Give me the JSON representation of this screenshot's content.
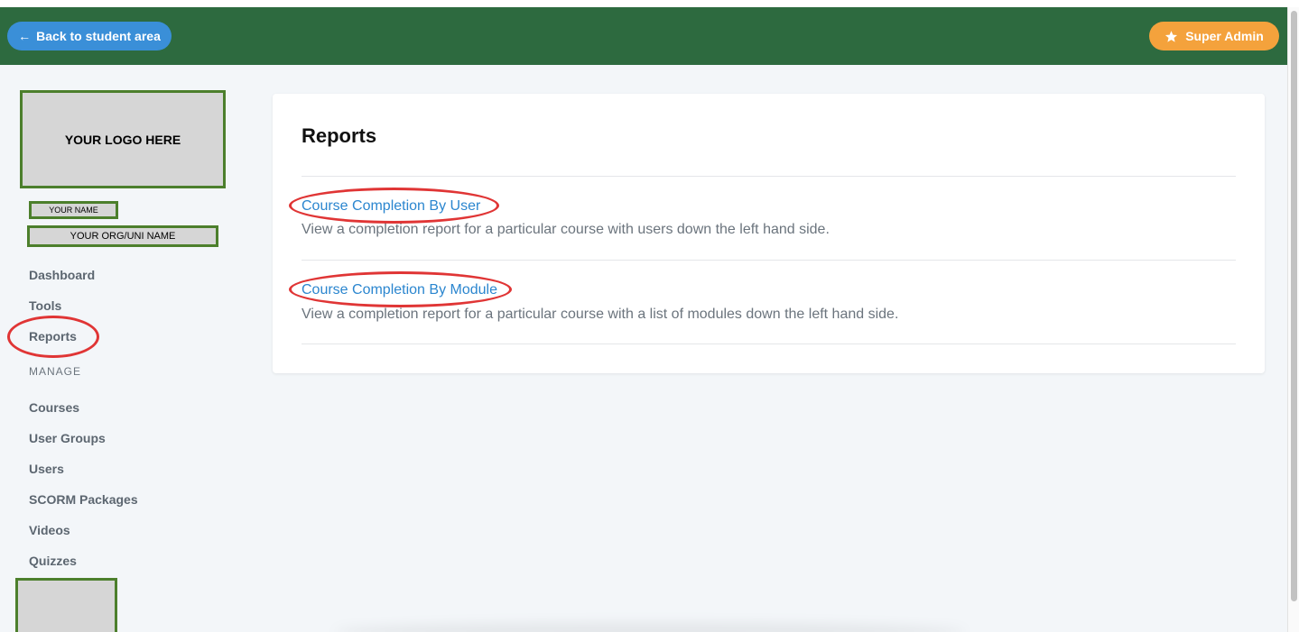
{
  "header": {
    "back_label": "Back to student area",
    "admin_label": "Super Admin"
  },
  "sidebar": {
    "logo_text": "YOUR LOGO HERE",
    "name_text": "YOUR NAME",
    "org_text": "YOUR ORG/UNI NAME",
    "items": [
      {
        "label": "Dashboard"
      },
      {
        "label": "Tools"
      },
      {
        "label": "Reports"
      }
    ],
    "manage_heading": "MANAGE",
    "manage_items": [
      {
        "label": "Courses"
      },
      {
        "label": "User Groups"
      },
      {
        "label": "Users"
      },
      {
        "label": "SCORM Packages"
      },
      {
        "label": "Videos"
      },
      {
        "label": "Quizzes"
      }
    ]
  },
  "main": {
    "title": "Reports",
    "reports": [
      {
        "link": "Course Completion By User",
        "description": "View a completion report for a particular course with users down the left hand side."
      },
      {
        "link": "Course Completion By Module",
        "description": "View a completion report for a particular course with a list of modules down the left hand side."
      }
    ]
  },
  "colors": {
    "header_bg": "#2d6a3f",
    "back_button": "#3a8fd8",
    "admin_button": "#f4a23c",
    "link": "#2b86cf",
    "annotation_red": "#e03535",
    "placeholder_border": "#4c7f2c"
  },
  "icons": {
    "back": "arrow-left-icon",
    "admin": "star-icon"
  }
}
